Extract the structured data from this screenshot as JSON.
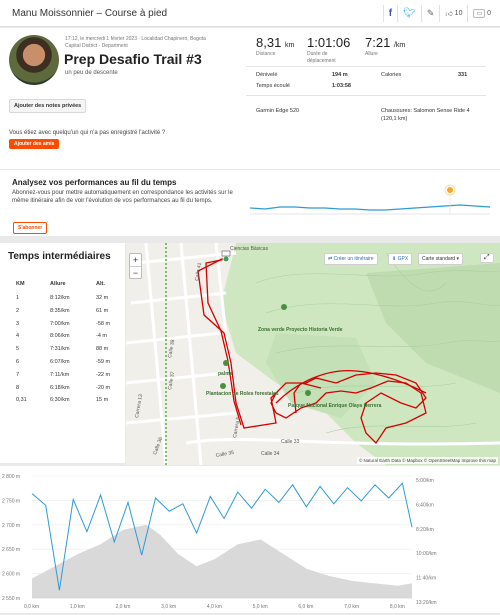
{
  "header": {
    "title": "Manu Moissonnier – Course à pied",
    "kudos_count": "10",
    "comment_count": "0",
    "icons": [
      "facebook-icon",
      "twitter-icon",
      "pencil-icon",
      "thumbs-up-icon",
      "comment-icon"
    ]
  },
  "activity": {
    "meta_line1": "17:12, le mercredi 1 février 2023 · Localidad Chapinero, Bogota",
    "meta_line2": "Capital District - Department",
    "title": "Prep Desafio Trail #3",
    "description": "un peu de descente",
    "notes_button": "Ajouter des notes privées",
    "friends_question": "Vous étiez avec quelqu'un qui n'a pas enregistré l'activité ?",
    "friends_button": "Ajouter des amis"
  },
  "stats": {
    "distance_value": "8,31",
    "distance_unit": "km",
    "distance_label": "Distance",
    "moving_time_value": "1:01:06",
    "moving_time_label_1": "Durée de",
    "moving_time_label_2": "déplacement",
    "pace_value": "7:21",
    "pace_unit": "/km",
    "pace_label": "Allure",
    "elevation_label": "Dénivelé",
    "elevation_value": "194 m",
    "calories_label": "Calories",
    "calories_value": "331",
    "elapsed_label": "Temps écoulé",
    "elapsed_value": "1:03:58",
    "device": "Garmin Edge 520",
    "shoes_line1": "Chaussures: Salomon Sense Ride 4",
    "shoes_line2": "(120,1 km)"
  },
  "analyze": {
    "title": "Analysez vos performances au fil du temps",
    "text": "Abonnez-vous pour mettre automatiquement en correspondance les activités sur le même itinéraire afin de voir l'évolution de vos performances au fil du temps.",
    "button": "S'abonner"
  },
  "splits": {
    "title": "Temps intermédiaires",
    "headers": [
      "KM",
      "Allure",
      "Alt."
    ],
    "rows": [
      [
        "1",
        "8:12/km",
        "32 m"
      ],
      [
        "2",
        "8:35/km",
        "61 m"
      ],
      [
        "3",
        "7:00/km",
        "-58 m"
      ],
      [
        "4",
        "8:06/km",
        "-4 m"
      ],
      [
        "5",
        "7:31/km",
        "88 m"
      ],
      [
        "6",
        "6:07/km",
        "-59 m"
      ],
      [
        "7",
        "7:11/km",
        "-22 m"
      ],
      [
        "8",
        "6:18/km",
        "-20 m"
      ],
      [
        "0,31",
        "6:30/km",
        "15 m"
      ]
    ]
  },
  "map": {
    "create_route": "Créer un itinéraire",
    "gpx": "GPX",
    "map_style": "Carte standard",
    "labels": [
      "Ciencias Básicas",
      "Calle 41",
      "Calle 38",
      "Calle 37",
      "Calle 36",
      "Calle 35",
      "Calle 34",
      "Carrera 13",
      "Carrera 5",
      "Calle 33",
      "palma",
      "Plantacion de Roles forestales",
      "Zona verde Proyecto Historia Verde",
      "Parque Nacional Enrique Olaya Herrera"
    ],
    "attribution": "© Natural Earth Data © Mapbox © OpenStreetMap Improve this map"
  },
  "elevation": {
    "y_left_ticks": [
      "2 800 m",
      "2 750 m",
      "2 700 m",
      "2 650 m",
      "2 600 m",
      "2 550 m"
    ],
    "y_right_ticks": [
      "5:00/km",
      "6:40/km",
      "8:20/km",
      "10:00/km",
      "11:40/km",
      "13:20/km"
    ],
    "x_ticks": [
      "0,0 km",
      "1,0 km",
      "2,0 km",
      "3,0 km",
      "4,0 km",
      "5,0 km",
      "6,0 km",
      "7,0 km",
      "8,0 km"
    ]
  },
  "chart_data": [
    {
      "type": "area",
      "title": "",
      "x_unit": "km",
      "x": [
        0.0,
        0.5,
        1.0,
        1.5,
        2.0,
        2.5,
        2.8,
        3.2,
        3.6,
        4.0,
        4.5,
        5.0,
        5.5,
        6.0,
        6.5,
        7.0,
        7.5,
        8.0,
        8.31
      ],
      "series": [
        {
          "y_unit": "m",
          "values": [
            2590,
            2615,
            2640,
            2660,
            2690,
            2700,
            2680,
            2640,
            2615,
            2630,
            2660,
            2670,
            2640,
            2610,
            2595,
            2585,
            2580,
            2575,
            2580
          ]
        }
      ],
      "xlim": [
        0,
        8.31
      ],
      "ylim": [
        2550,
        2800
      ]
    },
    {
      "type": "line",
      "title": "",
      "x_unit": "km",
      "x": [
        0.0,
        0.3,
        0.6,
        0.9,
        1.2,
        1.5,
        1.8,
        2.1,
        2.4,
        2.7,
        3.0,
        3.3,
        3.6,
        3.9,
        4.2,
        4.5,
        4.8,
        5.1,
        5.4,
        5.7,
        6.0,
        6.3,
        6.6,
        6.9,
        7.2,
        7.5,
        7.8,
        8.1,
        8.31
      ],
      "series": [
        {
          "y_unit": "min/km",
          "values": [
            6.2,
            7.0,
            12.8,
            6.6,
            8.8,
            6.3,
            9.5,
            6.8,
            10.4,
            6.5,
            7.4,
            6.9,
            8.9,
            6.4,
            7.9,
            6.1,
            7.2,
            5.9,
            6.8,
            5.6,
            7.1,
            5.7,
            6.9,
            5.8,
            6.7,
            5.6,
            6.5,
            5.5,
            8.5
          ]
        }
      ],
      "xlim": [
        0,
        8.31
      ],
      "ylim": [
        13.33,
        5.0
      ],
      "y_axis_side": "right"
    }
  ]
}
